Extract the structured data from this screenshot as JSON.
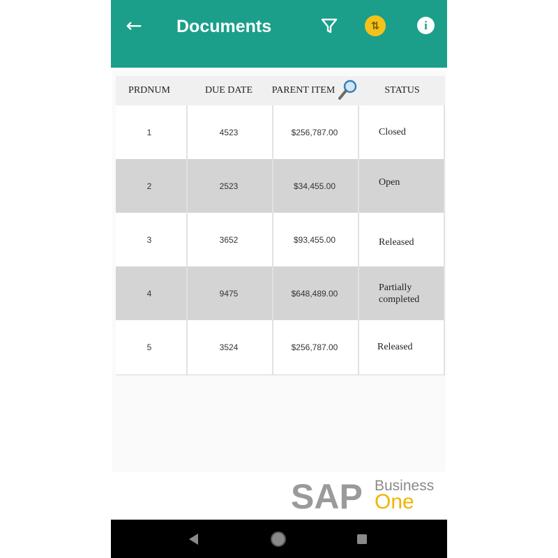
{
  "app_bar": {
    "title": "Documents",
    "color": "#1b9f8b",
    "icons": {
      "back": "arrow-left-icon",
      "filter": "filter-icon",
      "sort": "sort-icon",
      "info": "info-icon"
    },
    "back_glyph": "←",
    "sort_glyph": "⇅",
    "info_glyph": "i"
  },
  "table": {
    "columns": [
      "PRDNUM",
      "DUE DATE",
      "PARENT ITEM",
      "STATUS"
    ],
    "rows": [
      {
        "prdnum": "1",
        "due_date": "4523",
        "parent_item": "$256,787.00",
        "status": "Closed"
      },
      {
        "prdnum": "2",
        "due_date": "2523",
        "parent_item": "$34,455.00",
        "status": "Open"
      },
      {
        "prdnum": "3",
        "due_date": "3652",
        "parent_item": "$93,455.00",
        "status": "Released"
      },
      {
        "prdnum": "4",
        "due_date": "9475",
        "parent_item": "$648,489.00",
        "status": "Partially completed"
      },
      {
        "prdnum": "5",
        "due_date": "3524",
        "parent_item": "$256,787.00",
        "status": "Released"
      }
    ],
    "row_shade_color": "#d4d4d4"
  },
  "branding": {
    "logo_main": "SAP",
    "logo_sub_top": "Business",
    "logo_sub_bottom": "One",
    "logo_colors": {
      "sap": "#9a9a9a",
      "business": "#8a8a8a",
      "one": "#f0b400"
    }
  },
  "system_nav": {
    "icons": [
      "nav-back-icon",
      "nav-home-icon",
      "nav-recents-icon"
    ]
  }
}
